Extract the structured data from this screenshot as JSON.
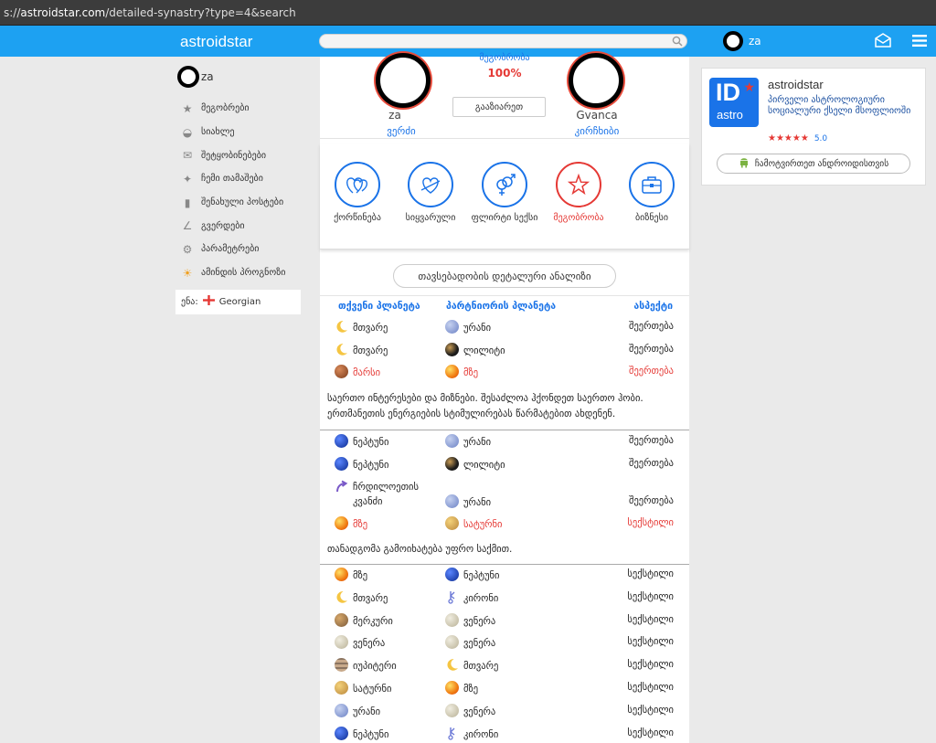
{
  "browser": {
    "url_prefix": "s://",
    "url_host": "astroidstar.com",
    "url_path": "/detailed-synastry?type=4&search"
  },
  "topnav": {
    "logo": "astroidstar",
    "search_placeholder": "",
    "username": "za"
  },
  "sidebar": {
    "username": "za",
    "items": [
      {
        "label": "მეგობრები",
        "icon": "star-icon"
      },
      {
        "label": "სიახლე",
        "icon": "eye-icon"
      },
      {
        "label": "შეტყობინებები",
        "icon": "mail-icon"
      },
      {
        "label": "ჩემი თამაშები",
        "icon": "gamepad-icon"
      },
      {
        "label": "შენახული პოსტები",
        "icon": "bookmark-icon"
      },
      {
        "label": "გვერდები",
        "icon": "pages-icon"
      },
      {
        "label": "პარამეტრები",
        "icon": "gear-icon"
      },
      {
        "label": "ამინდის პროგნოზი",
        "icon": "sun-icon"
      }
    ],
    "lang_label": "ენა:",
    "lang_value": "Georgian"
  },
  "profile": {
    "compat_label": "მეგობრობა",
    "compat_value": "100%",
    "expand_button": "გააზიარეთ",
    "person1": {
      "name": "za",
      "link": "ვერძი"
    },
    "person2": {
      "name": "Gvanca",
      "link": "კირჩხიბი"
    }
  },
  "types": [
    {
      "label": "ქორწინება",
      "icon": "rings-icon",
      "active": false
    },
    {
      "label": "სიყვარული",
      "icon": "hearts-icon",
      "active": false
    },
    {
      "label": "ფლირტი სექსი",
      "icon": "gender-icon",
      "active": false
    },
    {
      "label": "მეგობრობა",
      "icon": "star-icon",
      "active": true
    },
    {
      "label": "ბიზნესი",
      "icon": "briefcase-icon",
      "active": false
    }
  ],
  "detail_button": "თავსებადობის დეტალური ანალიზი",
  "table_headers": {
    "your_planet": "თქვენი პლანეტა",
    "partner_planet": "პარტნიორის პლანეტა",
    "aspect": "ასპექტი"
  },
  "group1": [
    {
      "p1": "მთვარე",
      "i1": "moon",
      "p2": "ურანი",
      "i2": "uranus",
      "aspect": "შეერთება",
      "highlight": false
    },
    {
      "p1": "მთვარე",
      "i1": "moon",
      "p2": "ლილიტი",
      "i2": "lilith",
      "aspect": "შეერთება",
      "highlight": false
    },
    {
      "p1": "მარსი",
      "i1": "mars",
      "p2": "მზე",
      "i2": "sun",
      "aspect": "შეერთება",
      "highlight": true
    }
  ],
  "group1_desc": "საერთო ინტერესები და მიზნები. შესაძლოა ჰქონდეთ საერთო ჰობი. ერთმანეთის ენერგიების სტიმულირებას წარმატებით ახდენენ.",
  "group2": [
    {
      "p1": "ნეპტუნი",
      "i1": "neptune",
      "p2": "ურანი",
      "i2": "uranus",
      "aspect": "შეერთება",
      "highlight": false
    },
    {
      "p1": "ნეპტუნი",
      "i1": "neptune",
      "p2": "ლილიტი",
      "i2": "lilith",
      "aspect": "შეერთება",
      "highlight": false
    },
    {
      "p1": "ჩრდილოეთის კვანძი",
      "i1": "node",
      "p2": "ურანი",
      "i2": "uranus",
      "aspect": "შეერთება",
      "highlight": false
    },
    {
      "p1": "მზე",
      "i1": "sun",
      "p2": "სატურნი",
      "i2": "saturn",
      "aspect": "სექსტილი",
      "highlight": true
    }
  ],
  "group2_desc": "თანადგომა გამოიხატება უფრო საქმით.",
  "group3": [
    {
      "p1": "მზე",
      "i1": "sun",
      "p2": "ნეპტუნი",
      "i2": "neptune",
      "aspect": "სექსტილი",
      "highlight": false
    },
    {
      "p1": "მთვარე",
      "i1": "moon",
      "p2": "კირონი",
      "i2": "chiron",
      "aspect": "სექსტილი",
      "highlight": false
    },
    {
      "p1": "მერკური",
      "i1": "mercury",
      "p2": "ვენერა",
      "i2": "venus",
      "aspect": "სექსტილი",
      "highlight": false
    },
    {
      "p1": "ვენერა",
      "i1": "venus",
      "p2": "ვენერა",
      "i2": "venus",
      "aspect": "სექსტილი",
      "highlight": false
    },
    {
      "p1": "იუპიტერი",
      "i1": "jupiter",
      "p2": "მთვარე",
      "i2": "moon",
      "aspect": "სექსტილი",
      "highlight": false
    },
    {
      "p1": "სატურნი",
      "i1": "saturn",
      "p2": "მზე",
      "i2": "sun",
      "aspect": "სექსტილი",
      "highlight": false
    },
    {
      "p1": "ურანი",
      "i1": "uranus",
      "p2": "ვენერა",
      "i2": "venus",
      "aspect": "სექსტილი",
      "highlight": false
    },
    {
      "p1": "ნეპტუნი",
      "i1": "neptune",
      "p2": "კირონი",
      "i2": "chiron",
      "aspect": "სექსტილი",
      "highlight": false
    }
  ],
  "ad": {
    "logo_top": "ID",
    "logo_bottom": "astro",
    "title": "astroidstar",
    "subtitle": "პირველი ასტროლოგიური სოციალური ქსელი მსოფლიოში",
    "stars": "★★★★★",
    "rating": "5.0",
    "button": "ჩამოტვირთეთ ანდროიდისთვის"
  },
  "colors": {
    "brand": "#1da1f2",
    "link": "#1a73e8",
    "highlight": "#e53935"
  }
}
